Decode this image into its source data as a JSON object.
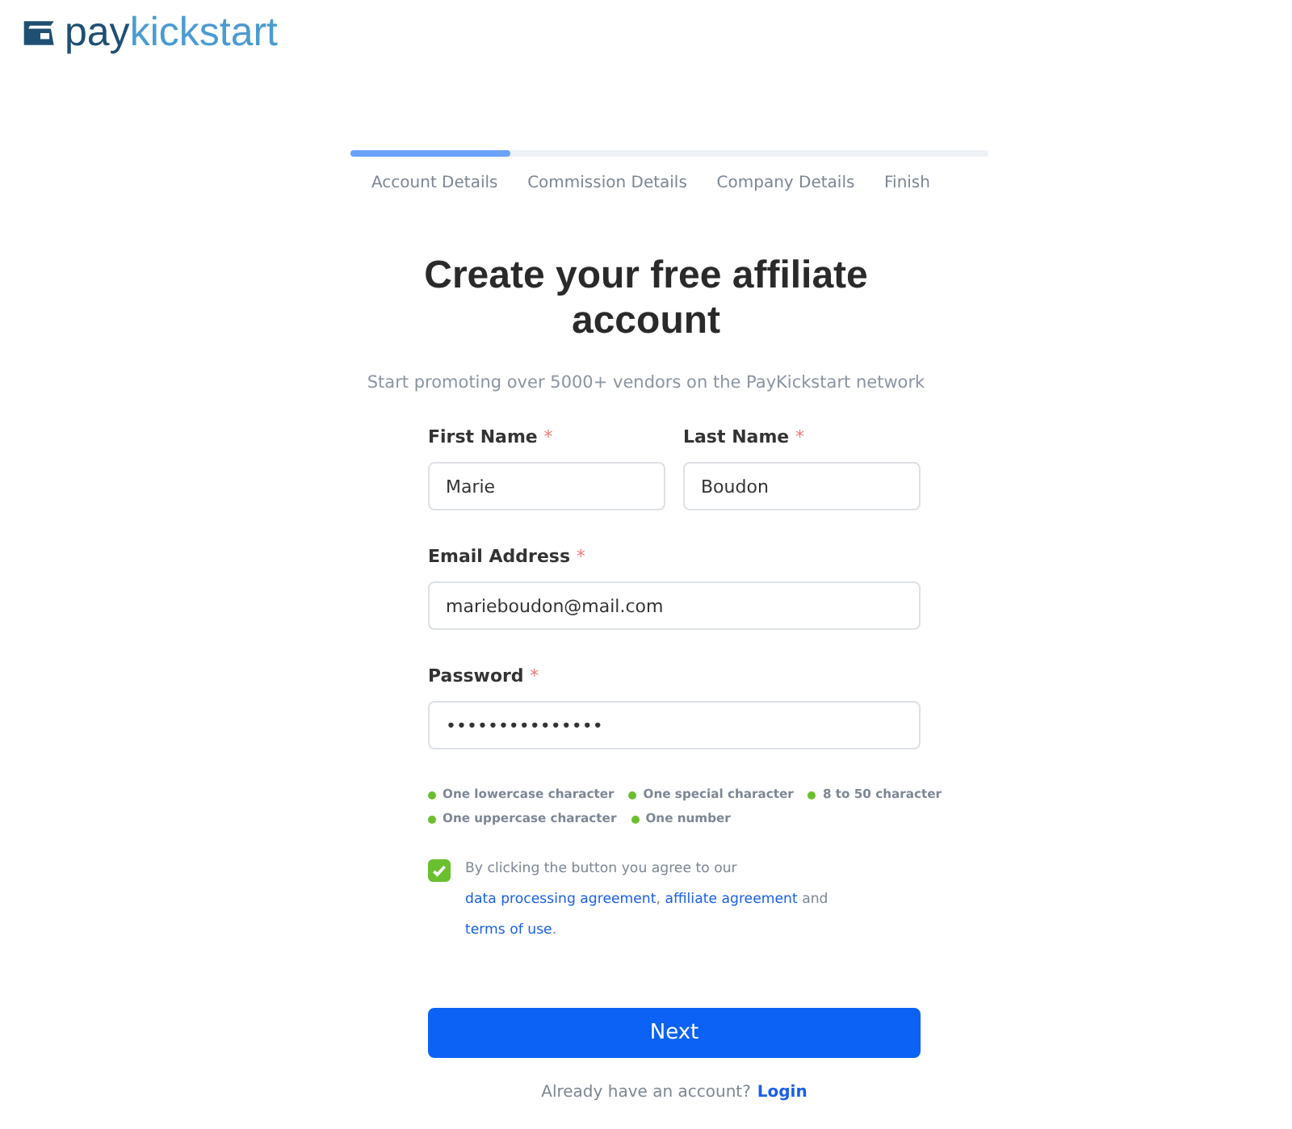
{
  "logo": {
    "text_bold": "pay",
    "text_light": "kickstart"
  },
  "progress": {
    "level": 0.25,
    "steps": [
      {
        "label": "Account Details"
      },
      {
        "label": "Commission Details"
      },
      {
        "label": "Company Details"
      },
      {
        "label": "Finish"
      }
    ]
  },
  "title": "Create your free affiliate account",
  "subtitle": "Start promoting over 5000+ vendors on the PayKickstart network",
  "field_rows": [
    [
      {
        "label": "First Name",
        "required_mark": "*",
        "value": "Marie"
      },
      {
        "label": "Last Name",
        "required_mark": "*",
        "value": "Boudon"
      }
    ],
    [
      {
        "label": "Email Address",
        "required_mark": "*",
        "value": "marieboudon@mail.com"
      }
    ],
    [
      {
        "label": "Password",
        "required_mark": "*",
        "value": "•••••••••••••••"
      }
    ]
  ],
  "requirements": [
    [
      {
        "text": "One lowercase character",
        "met": true
      },
      {
        "text": "One special character",
        "met": true
      },
      {
        "text": "8 to 50 character",
        "met": true
      }
    ],
    [
      {
        "text": "One uppercase character",
        "met": true
      },
      {
        "text": "One number",
        "met": true
      }
    ]
  ],
  "agreement": {
    "checked": true,
    "parts": [
      {
        "text": "By clicking the button you agree to our ",
        "link": false
      },
      {
        "text": "data processing agreement",
        "link": true
      },
      {
        "text": ", ",
        "link": false
      },
      {
        "text": "affiliate agreement",
        "link": true
      },
      {
        "text": " and ",
        "link": false
      },
      {
        "text": "terms of use",
        "link": true
      },
      {
        "text": ".",
        "link": false
      }
    ]
  },
  "next_button": "Next",
  "footer": {
    "text": "Already have an account?",
    "link": "Login"
  }
}
